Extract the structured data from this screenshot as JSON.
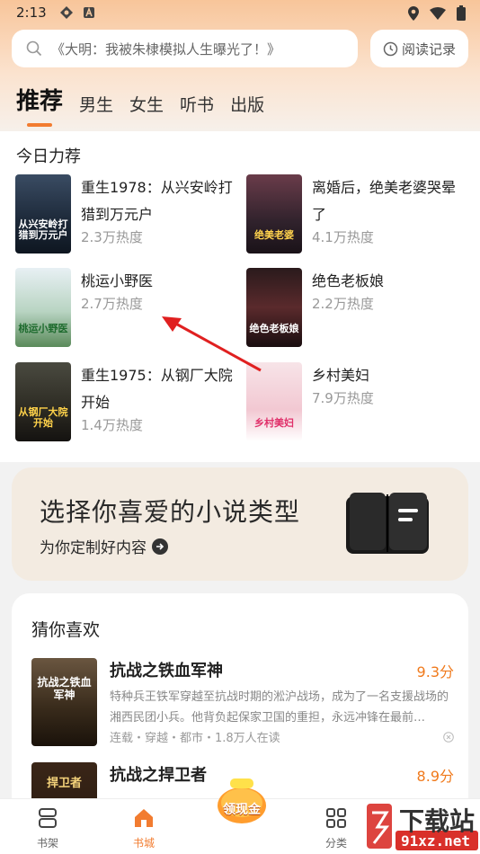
{
  "status": {
    "time": "2:13"
  },
  "search": {
    "placeholder": "《大明：我被朱棣模拟人生曝光了！》",
    "history_label": "阅读记录"
  },
  "tabs": [
    {
      "label": "推荐"
    },
    {
      "label": "男生"
    },
    {
      "label": "女生"
    },
    {
      "label": "听书"
    },
    {
      "label": "出版"
    }
  ],
  "today": {
    "title": "今日力荐",
    "books": [
      {
        "title": "重生1978：从兴安岭打猎到万元户",
        "heat": "2.3万热度",
        "cover_text": "从兴安岭打猎到万元户"
      },
      {
        "title": "离婚后，绝美老婆哭晕了",
        "heat": "4.1万热度",
        "cover_text": "绝美老婆"
      },
      {
        "title": "桃运小野医",
        "heat": "2.7万热度",
        "cover_text": "桃运小野医"
      },
      {
        "title": "绝色老板娘",
        "heat": "2.2万热度",
        "cover_text": "绝色老板娘"
      },
      {
        "title": "重生1975：从钢厂大院开始",
        "heat": "1.4万热度",
        "cover_text": "从钢厂大院开始"
      },
      {
        "title": "乡村美妇",
        "heat": "7.9万热度",
        "cover_text": "乡村美妇"
      }
    ]
  },
  "banner": {
    "title": "选择你喜爱的小说类型",
    "subtitle": "为你定制好内容"
  },
  "guess": {
    "title": "猜你喜欢",
    "items": [
      {
        "title": "抗战之铁血军神",
        "score": "9.3分",
        "desc": "特种兵王铁军穿越至抗战时期的淞沪战场，成为了一名支援战场的湘西民团小兵。他背负起保家卫国的重担，永远冲锋在最前…",
        "tags": "连载・穿越・都市・1.8万人在读",
        "cover_text": "抗战之铁血军神"
      },
      {
        "title": "抗战之捍卫者",
        "score": "8.9分",
        "desc": "",
        "tags": "",
        "cover_text": "捍卫者"
      }
    ]
  },
  "nav": {
    "shelf": "书架",
    "store": "书城",
    "reward": "领现金",
    "category": "分类"
  },
  "colors": {
    "accent": "#f27c30",
    "score": "#f07a1c"
  },
  "watermark": {
    "text": "下载站",
    "url_text": "91xz.net"
  }
}
